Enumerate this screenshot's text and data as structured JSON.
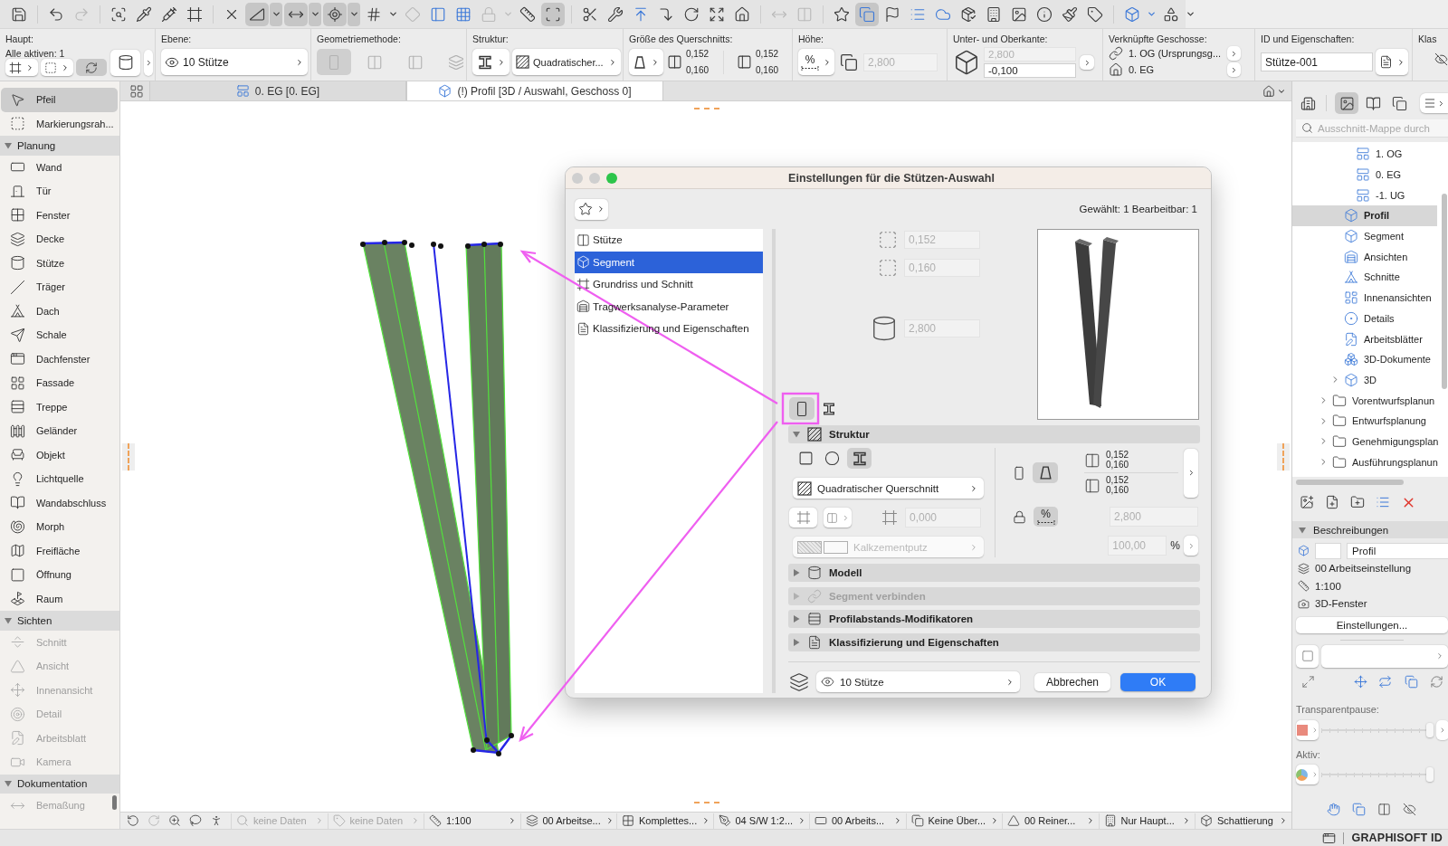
{
  "toolbar": {
    "groups": [
      {
        "buttons": [
          {
            "pressed": false,
            "menu": false,
            "disabled": false
          }
        ]
      },
      {
        "buttons": [
          {
            "pressed": false,
            "menu": false,
            "disabled": false
          },
          {
            "pressed": false,
            "menu": false,
            "disabled": true
          }
        ]
      },
      {
        "buttons": [
          {
            "pressed": false,
            "menu": false,
            "disabled": false
          },
          {
            "pressed": false,
            "menu": false,
            "disabled": false
          },
          {
            "pressed": false,
            "menu": false,
            "disabled": false
          },
          {
            "pressed": false,
            "menu": false,
            "disabled": false
          }
        ]
      },
      {
        "buttons": [
          {
            "pressed": false,
            "menu": false,
            "disabled": false
          },
          {
            "pressed": true,
            "menu": true,
            "disabled": false
          },
          {
            "pressed": true,
            "menu": true,
            "disabled": false
          },
          {
            "pressed": true,
            "menu": true,
            "disabled": false
          },
          {
            "pressed": false,
            "menu": true,
            "disabled": false
          },
          {
            "pressed": false,
            "menu": false,
            "disabled": true
          },
          {
            "pressed": false,
            "menu": false,
            "disabled": false
          },
          {
            "pressed": false,
            "menu": false,
            "disabled": false
          },
          {
            "pressed": false,
            "menu": true,
            "disabled": true
          },
          {
            "pressed": false,
            "menu": false,
            "disabled": false
          },
          {
            "pressed": true,
            "menu": false,
            "disabled": false
          }
        ]
      },
      {
        "buttons": [
          {
            "pressed": false,
            "menu": false,
            "disabled": false
          },
          {
            "pressed": false,
            "menu": false,
            "disabled": false
          },
          {
            "pressed": false,
            "menu": false,
            "disabled": false
          },
          {
            "pressed": false,
            "menu": false,
            "disabled": false
          },
          {
            "pressed": false,
            "menu": false,
            "disabled": false
          },
          {
            "pressed": false,
            "menu": false,
            "disabled": false
          },
          {
            "pressed": false,
            "menu": false,
            "disabled": false
          }
        ]
      },
      {
        "buttons": [
          {
            "pressed": false,
            "menu": false,
            "disabled": true
          },
          {
            "pressed": false,
            "menu": false,
            "disabled": true
          }
        ]
      },
      {
        "buttons": [
          {
            "pressed": false,
            "menu": false,
            "disabled": false
          },
          {
            "pressed": true,
            "menu": false,
            "disabled": false
          },
          {
            "pressed": false,
            "menu": false,
            "disabled": false
          },
          {
            "pressed": false,
            "menu": false,
            "disabled": false
          },
          {
            "pressed": false,
            "menu": false,
            "disabled": false
          },
          {
            "pressed": false,
            "menu": false,
            "disabled": false
          },
          {
            "pressed": false,
            "menu": false,
            "disabled": false
          },
          {
            "pressed": false,
            "menu": false,
            "disabled": false
          },
          {
            "pressed": false,
            "menu": false,
            "disabled": false
          },
          {
            "pressed": false,
            "menu": false,
            "disabled": false
          },
          {
            "pressed": false,
            "menu": false,
            "disabled": false
          }
        ]
      },
      {
        "buttons": [
          {
            "pressed": false,
            "menu": true,
            "disabled": false
          },
          {
            "pressed": false,
            "menu": true,
            "disabled": false
          }
        ]
      }
    ]
  },
  "info_box": {
    "main": {
      "title": "Haupt:",
      "subtitle": "Alle aktiven: 1",
      "tools": [
        {
          "pressed": false
        },
        {
          "pressed": false
        },
        {
          "pressed": true
        }
      ]
    },
    "layer": {
      "title": "Ebene:",
      "value": "10 Stütze"
    },
    "geometry": {
      "title": "Geometriemethode:",
      "options": [
        {
          "selected": true
        },
        {
          "selected": false
        },
        {
          "selected": false
        },
        {
          "selected": false
        }
      ]
    },
    "structure": {
      "title": "Struktur:",
      "profile": "Quadratischer..."
    },
    "cross_section": {
      "title": "Größe des Querschnitts:",
      "start": [
        "0,152",
        "0,160"
      ],
      "end": [
        "0,152",
        "0,160"
      ]
    },
    "height": {
      "title": "Höhe:",
      "mode": "%",
      "field": {
        "value": "2,800",
        "disabled": true
      }
    },
    "elevations": {
      "title": "Unter- und Oberkante:",
      "top": {
        "value": "2,800",
        "disabled": true
      },
      "bottom": {
        "value": "-0,100",
        "disabled": false
      }
    },
    "linked_stories": {
      "title": "Verknüpfte Geschosse:",
      "top": "1. OG (Ursprungsg...",
      "bottom": "0. EG"
    },
    "id": {
      "title": "ID und Eigenschaften:",
      "value": "Stütze-001"
    },
    "classification": {
      "title": "Klas"
    }
  },
  "tabs": [
    {
      "label": "0. EG [0. EG]",
      "kind": "plan",
      "selected": false
    },
    {
      "label": "(!) Profil [3D / Auswahl, Geschoss 0]",
      "kind": "perspective",
      "selected": true
    }
  ],
  "toolbox": {
    "tools": [
      {
        "label": "Pfeil",
        "selected": true,
        "disabled": false
      },
      {
        "label": "Markierungsrah...",
        "selected": false,
        "disabled": false
      }
    ],
    "groups": [
      {
        "title": "Planung",
        "expanded": true,
        "tools": [
          {
            "label": "Wand",
            "selected": false,
            "disabled": false
          },
          {
            "label": "Tür",
            "selected": false,
            "disabled": false
          },
          {
            "label": "Fenster",
            "selected": false,
            "disabled": false
          },
          {
            "label": "Decke",
            "selected": false,
            "disabled": false
          },
          {
            "label": "Stütze",
            "selected": false,
            "disabled": false
          },
          {
            "label": "Träger",
            "selected": false,
            "disabled": false
          },
          {
            "label": "Dach",
            "selected": false,
            "disabled": false
          },
          {
            "label": "Schale",
            "selected": false,
            "disabled": false
          },
          {
            "label": "Dachfenster",
            "selected": false,
            "disabled": false
          },
          {
            "label": "Fassade",
            "selected": false,
            "disabled": false
          },
          {
            "label": "Treppe",
            "selected": false,
            "disabled": false
          },
          {
            "label": "Geländer",
            "selected": false,
            "disabled": false
          },
          {
            "label": "Objekt",
            "selected": false,
            "disabled": false
          },
          {
            "label": "Lichtquelle",
            "selected": false,
            "disabled": false
          },
          {
            "label": "Wandabschluss",
            "selected": false,
            "disabled": false
          },
          {
            "label": "Morph",
            "selected": false,
            "disabled": false
          },
          {
            "label": "Freifläche",
            "selected": false,
            "disabled": false
          },
          {
            "label": "Öffnung",
            "selected": false,
            "disabled": false
          },
          {
            "label": "Raum",
            "selected": false,
            "disabled": false
          }
        ]
      },
      {
        "title": "Sichten",
        "expanded": true,
        "tools": [
          {
            "label": "Schnitt",
            "selected": false,
            "disabled": true
          },
          {
            "label": "Ansicht",
            "selected": false,
            "disabled": true
          },
          {
            "label": "Innenansicht",
            "selected": false,
            "disabled": true
          },
          {
            "label": "Detail",
            "selected": false,
            "disabled": true
          },
          {
            "label": "Arbeitsblatt",
            "selected": false,
            "disabled": true
          },
          {
            "label": "Kamera",
            "selected": false,
            "disabled": true
          }
        ]
      },
      {
        "title": "Dokumentation",
        "expanded": true,
        "tools": [
          {
            "label": "Bemaßung",
            "selected": false,
            "disabled": true
          }
        ]
      }
    ]
  },
  "dialog": {
    "title": "Einstellungen für die Stützen-Auswahl",
    "selection_info": "Gewählt: 1 Bearbeitbar: 1",
    "pages": [
      {
        "label": "Stütze",
        "selected": false
      },
      {
        "label": "Segment",
        "selected": true
      },
      {
        "label": "Grundriss und Schnitt",
        "selected": false
      },
      {
        "label": "Tragwerksanalyse-Parameter",
        "selected": false
      },
      {
        "label": "Klassifizierung und Eigenschaften",
        "selected": false
      }
    ],
    "size_fields": [
      {
        "value": "0,152",
        "disabled": true
      },
      {
        "value": "0,160",
        "disabled": true
      },
      {
        "value": "2,800",
        "disabled": true
      }
    ],
    "segment_types": [
      {
        "selected": true
      },
      {
        "selected": false
      }
    ],
    "structure": {
      "title": "Struktur",
      "expanded": true,
      "shapes": [
        {
          "selected": false
        },
        {
          "selected": false
        },
        {
          "selected": true
        }
      ],
      "profile": "Quadratischer Querschnitt",
      "core_field": {
        "value": "0,000",
        "disabled": true
      },
      "material": {
        "value": "Kalkzementputz",
        "disabled": true
      },
      "taper": [
        {
          "selected": false
        },
        {
          "selected": true
        }
      ],
      "start_size": [
        "0,152",
        "0,160"
      ],
      "end_size": [
        "0,152",
        "0,160"
      ],
      "height_lock": {
        "selected": false
      },
      "height_percent": {
        "label": "%",
        "selected": true
      },
      "height_field": {
        "value": "2,800",
        "disabled": true
      },
      "ratio_field": {
        "value": "100,00",
        "disabled": true
      },
      "ratio_unit": "%"
    },
    "sections": [
      {
        "title": "Modell",
        "expanded": false,
        "disabled": false
      },
      {
        "title": "Segment verbinden",
        "expanded": false,
        "disabled": true
      },
      {
        "title": "Profilabstands-Modifikatoren",
        "expanded": false,
        "disabled": false
      },
      {
        "title": "Klassifizierung und Eigenschaften",
        "expanded": false,
        "disabled": false
      }
    ],
    "layer": "10 Stütze",
    "buttons": [
      {
        "label": "Abbrechen",
        "kind": "secondary"
      },
      {
        "label": "OK",
        "kind": "primary"
      }
    ]
  },
  "navigator": {
    "tabs": [
      {
        "selected": false
      },
      {
        "selected": true
      },
      {
        "selected": false
      },
      {
        "selected": false
      }
    ],
    "search": {
      "placeholder": "Ausschnitt-Mappe durch"
    },
    "tree": [
      {
        "children": [
          {
            "children": [
              {
                "label": "1. OG",
                "kind": "story",
                "selected": false
              },
              {
                "label": "0. EG",
                "kind": "story",
                "selected": false
              },
              {
                "label": "-1. UG",
                "kind": "story",
                "selected": false
              }
            ]
          },
          {
            "label": "Profil",
            "kind": "view",
            "selected": true
          },
          {
            "label": "Segment",
            "kind": "view",
            "selected": false
          },
          {
            "label": "Ansichten",
            "kind": "elevation",
            "selected": false
          },
          {
            "label": "Schnitte",
            "kind": "section",
            "selected": false
          },
          {
            "label": "Innenansichten",
            "kind": "interior",
            "selected": false
          },
          {
            "label": "Details",
            "kind": "detail",
            "selected": false
          },
          {
            "label": "Arbeitsblätter",
            "kind": "worksheet",
            "selected": false
          },
          {
            "label": "3D-Dokumente",
            "kind": "document",
            "selected": false
          },
          {
            "label": "3D",
            "kind": "view",
            "selected": false,
            "expanded": false
          }
        ]
      },
      {
        "label": "Vorentwurfsplanun",
        "kind": "folder",
        "selected": false,
        "expanded": false
      },
      {
        "label": "Entwurfsplanung",
        "kind": "folder",
        "selected": false,
        "expanded": false
      },
      {
        "label": "Genehmigungsplan",
        "kind": "folder",
        "selected": false,
        "expanded": false
      },
      {
        "label": "Ausführungsplanun",
        "kind": "folder",
        "selected": false,
        "expanded": false
      }
    ],
    "description": {
      "title": "Beschreibungen",
      "expanded": true,
      "name": "Profil",
      "layer_combination": "00 Arbeitseinstellung",
      "scale": "1:100",
      "source": "3D-Fenster",
      "settings_button": "Einstellungen..."
    },
    "transparency": {
      "label": "Transparentpause:",
      "level": 1
    },
    "active": {
      "label": "Aktiv:",
      "level": 1
    }
  },
  "status_bar": {
    "items": [
      {
        "label": "keine Daten",
        "disabled": true
      },
      {
        "label": "keine Daten",
        "disabled": true
      },
      {
        "label": "1:100",
        "disabled": false
      },
      {
        "label": "00 Arbeitse...",
        "disabled": false
      },
      {
        "label": "Komplettes...",
        "disabled": false
      },
      {
        "label": "04 S/W 1:2...",
        "disabled": false
      },
      {
        "label": "00 Arbeits...",
        "disabled": false
      },
      {
        "label": "Keine Über...",
        "disabled": false
      },
      {
        "label": "00 Reiner...",
        "disabled": false
      },
      {
        "label": "Nur Haupt...",
        "disabled": false
      },
      {
        "label": "Schattierung",
        "disabled": false
      }
    ]
  },
  "footer": {
    "brand": "GRAPHISOFT ID"
  }
}
